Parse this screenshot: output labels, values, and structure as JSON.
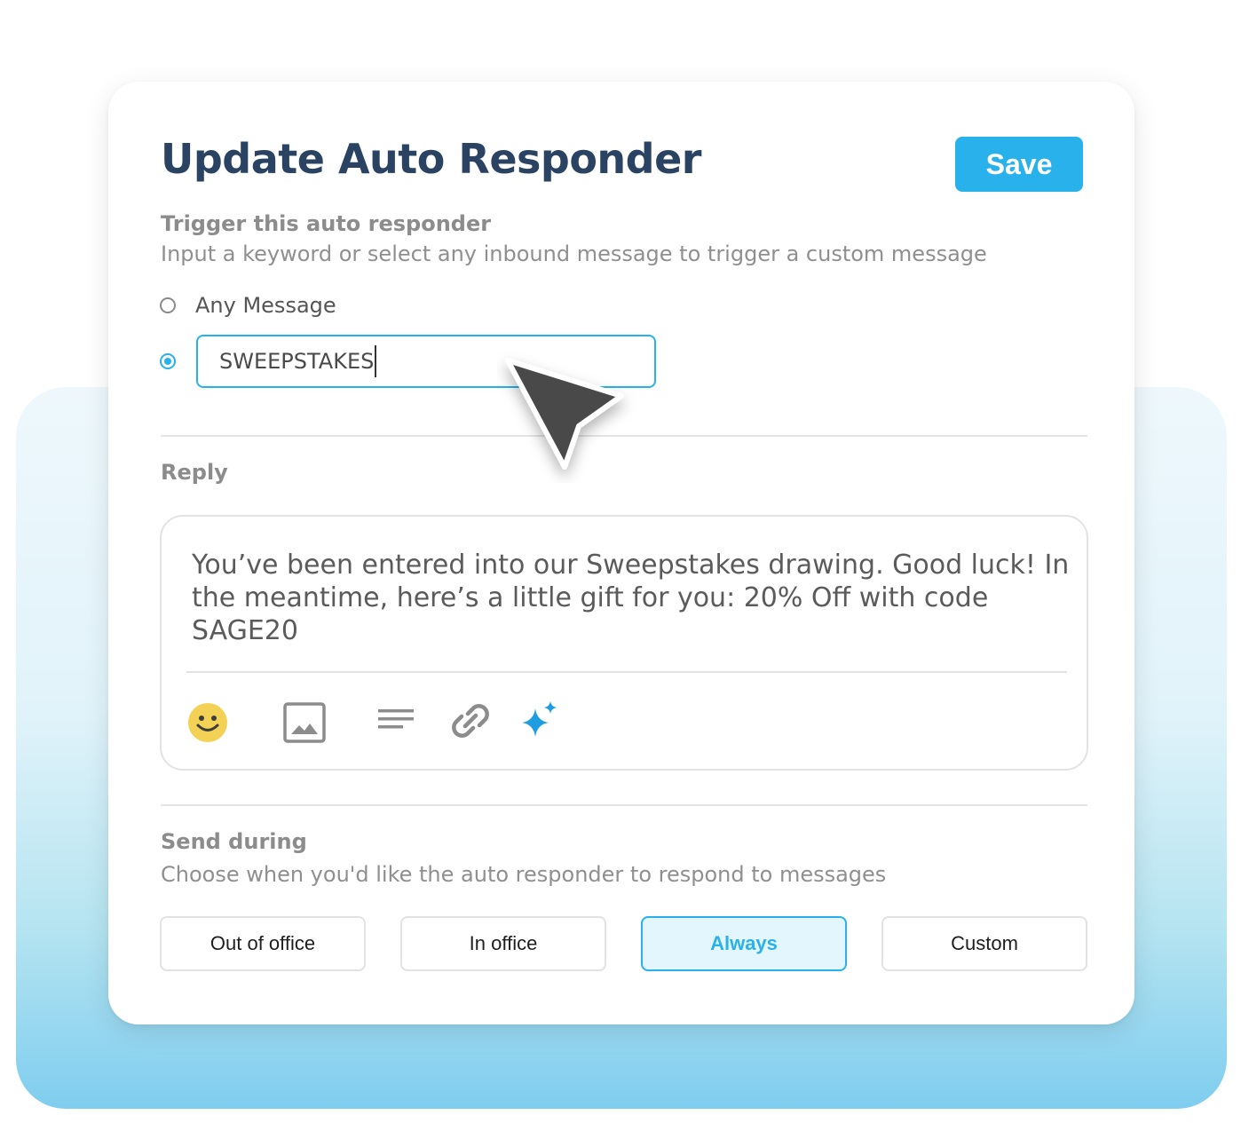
{
  "header": {
    "title": "Update Auto Responder",
    "save_label": "Save"
  },
  "trigger": {
    "label": "Trigger this auto responder",
    "description": "Input a keyword or select any inbound message to trigger a custom message",
    "options": [
      {
        "label": "Any Message",
        "selected": false
      },
      {
        "value": "SWEEPSTAKES",
        "selected": true
      }
    ]
  },
  "reply": {
    "label": "Reply",
    "message": "You’ve been entered into our Sweepstakes drawing. Good luck! In the meantime, here’s a little gift for you: 20% Off with code SAGE20",
    "toolbar": [
      "emoji-icon",
      "image-icon",
      "text-format-icon",
      "link-icon",
      "sparkle-icon"
    ]
  },
  "send_during": {
    "label": "Send during",
    "description": "Choose when you'd like the auto responder to respond to messages",
    "options": [
      {
        "label": "Out of office",
        "selected": false
      },
      {
        "label": "In office",
        "selected": false
      },
      {
        "label": "Always",
        "selected": true
      },
      {
        "label": "Custom",
        "selected": false
      }
    ]
  },
  "colors": {
    "accent": "#29b1ec",
    "title": "#2a4363",
    "emoji": "#f3d154"
  }
}
